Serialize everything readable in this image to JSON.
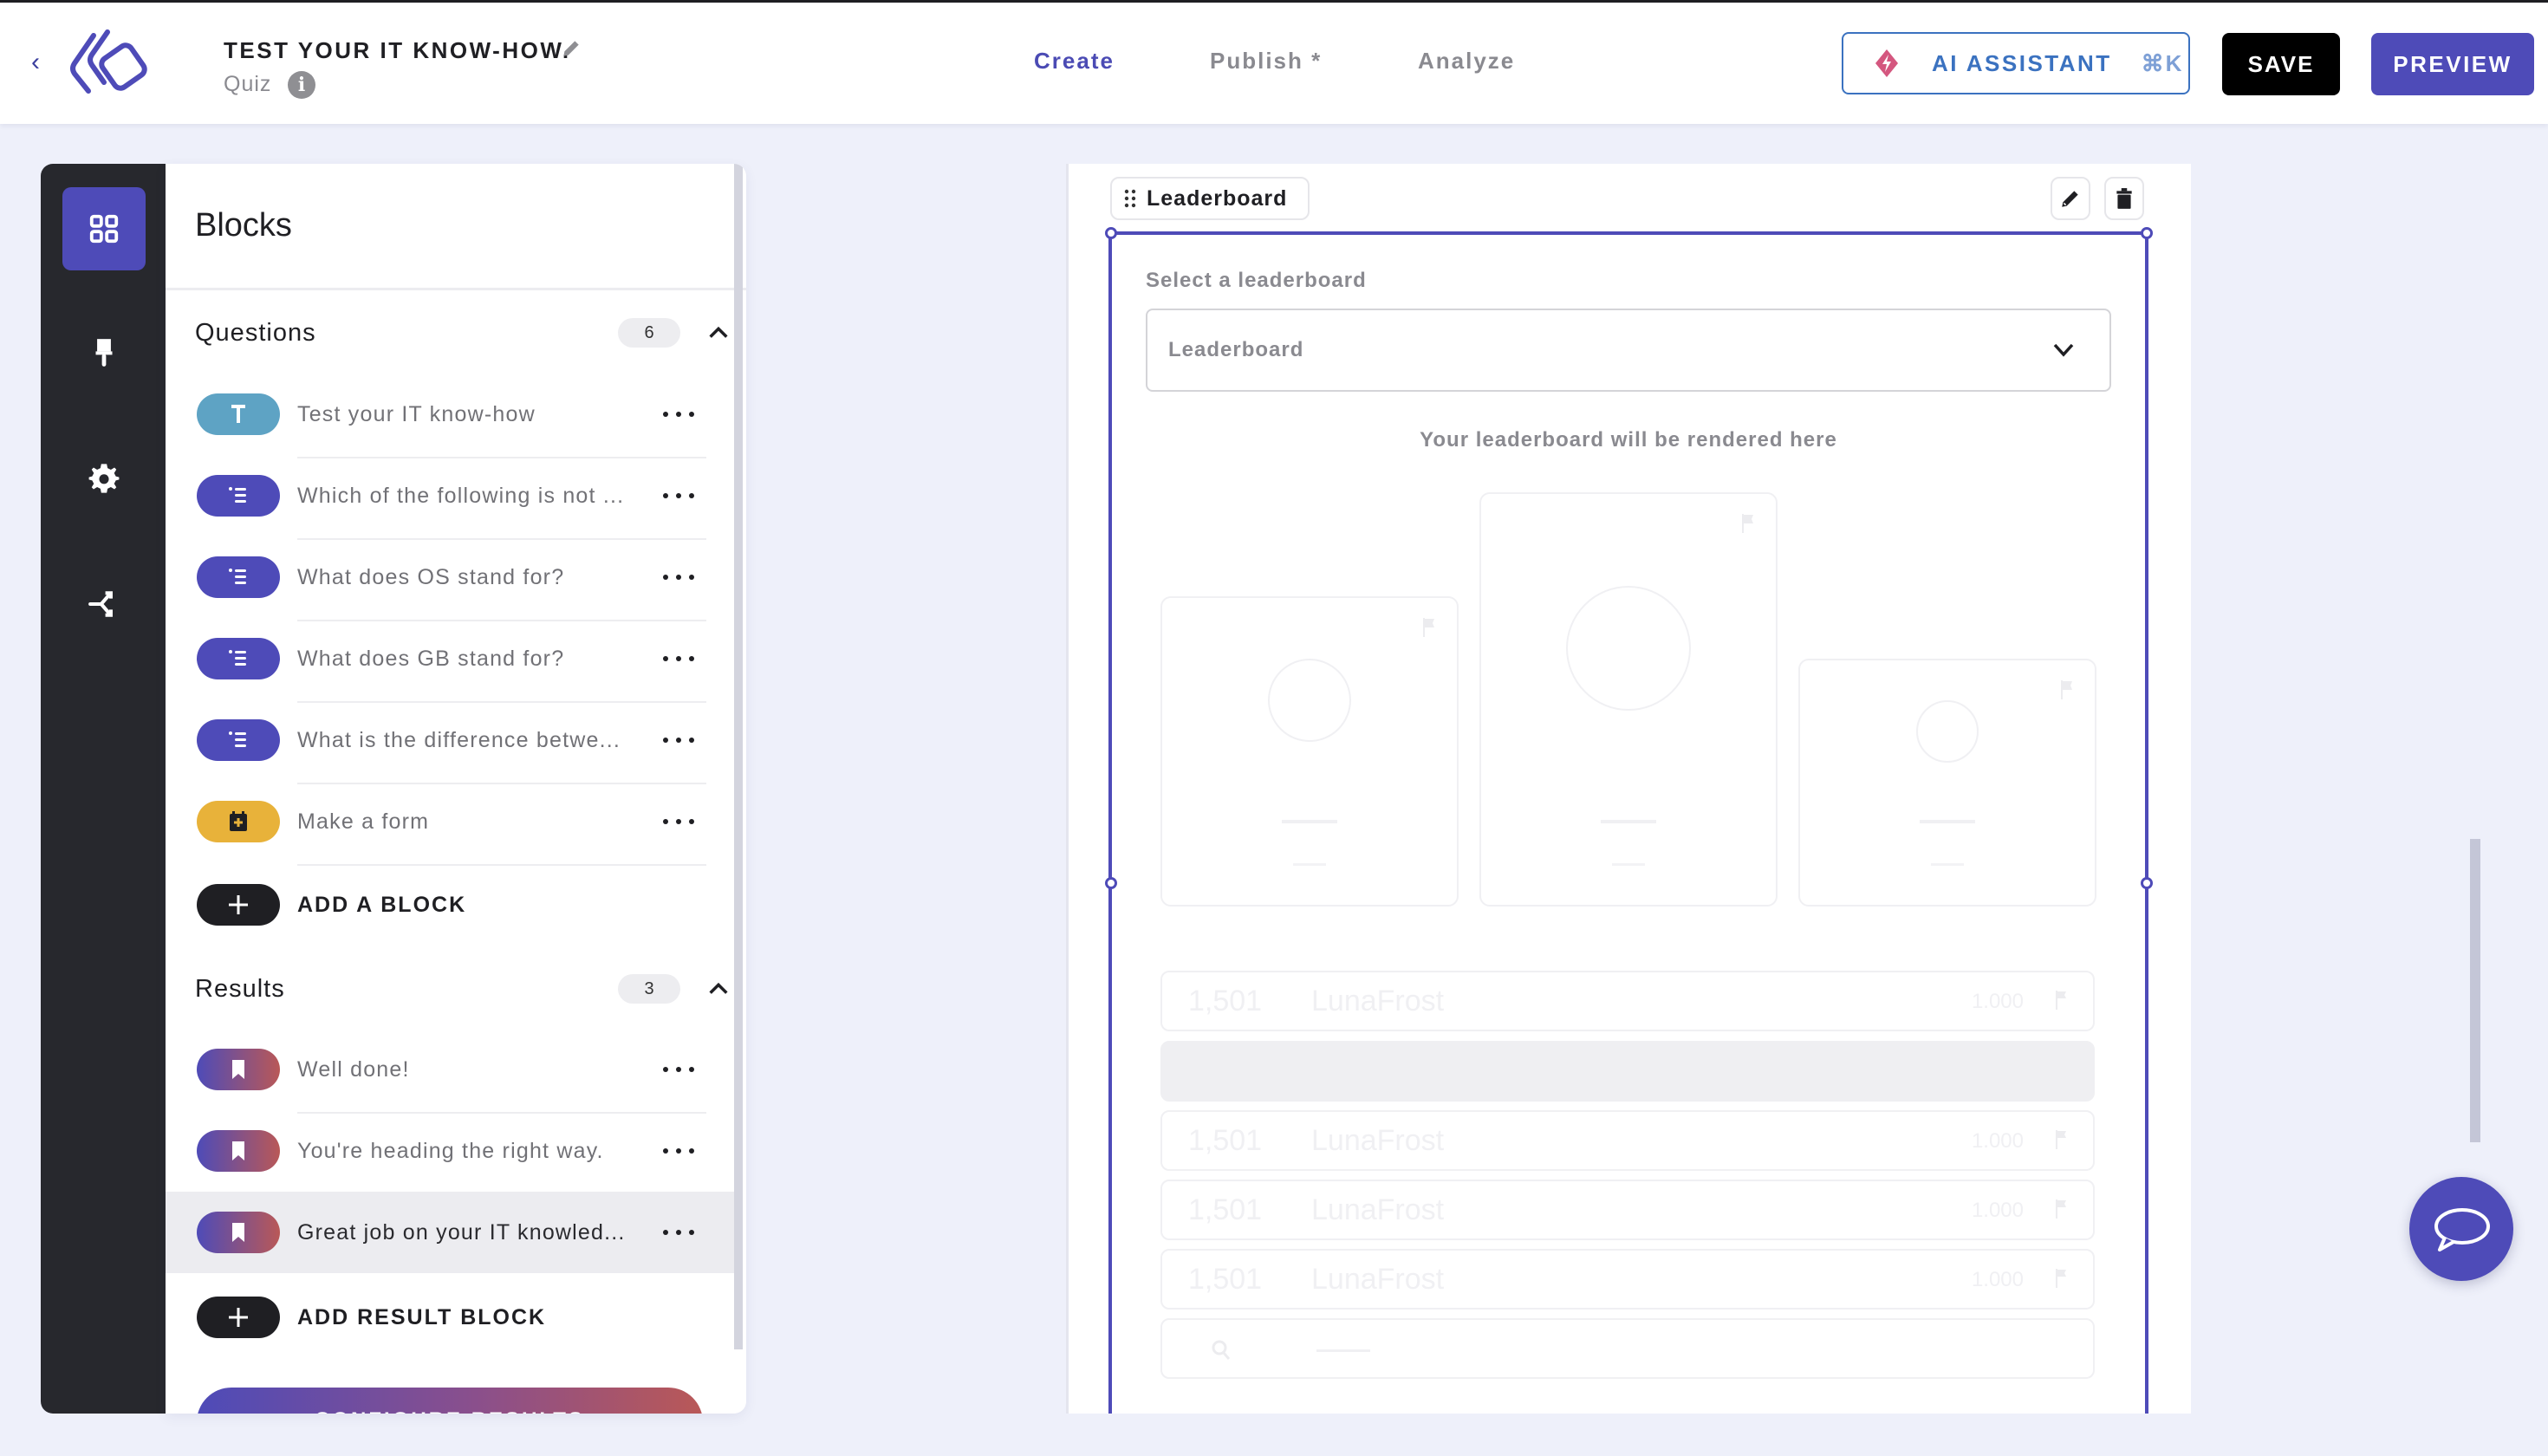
{
  "header": {
    "title": "TEST YOUR IT KNOW-HOW.",
    "type": "Quiz",
    "nav": [
      {
        "label": "Create",
        "active": true
      },
      {
        "label": "Publish *",
        "active": false
      },
      {
        "label": "Analyze",
        "active": false
      }
    ],
    "ai_assistant_label": "AI ASSISTANT",
    "ai_assistant_shortcut": "⌘K",
    "save_label": "SAVE",
    "preview_label": "PREVIEW"
  },
  "rail": {
    "items": [
      {
        "icon": "blocks-grid-icon",
        "active": true
      },
      {
        "icon": "paint-brush-icon",
        "active": false
      },
      {
        "icon": "gear-icon",
        "active": false
      },
      {
        "icon": "branch-logic-icon",
        "active": false
      }
    ]
  },
  "panel": {
    "title": "Blocks",
    "questions": {
      "title": "Questions",
      "count": "6",
      "items": [
        {
          "icon": "text-icon",
          "type": "text",
          "label": "Test your IT know-how"
        },
        {
          "icon": "list-icon",
          "type": "question",
          "label": "Which of the following is not ..."
        },
        {
          "icon": "list-icon",
          "type": "question",
          "label": "What does OS stand for?"
        },
        {
          "icon": "list-icon",
          "type": "question",
          "label": "What does GB stand for?"
        },
        {
          "icon": "list-icon",
          "type": "question",
          "label": "What is the difference betwe..."
        },
        {
          "icon": "form-icon",
          "type": "form",
          "label": "Make a form"
        }
      ],
      "add_label": "ADD A BLOCK"
    },
    "results": {
      "title": "Results",
      "count": "3",
      "items": [
        {
          "icon": "bookmark-icon",
          "label": "Well done!",
          "selected": false
        },
        {
          "icon": "bookmark-icon",
          "label": "You're heading the right way.",
          "selected": false
        },
        {
          "icon": "bookmark-icon",
          "label": "Great job on your IT knowled...",
          "selected": true
        }
      ],
      "add_label": "ADD RESULT BLOCK"
    },
    "configure_label": "CONFIGURE RESULTS"
  },
  "canvas": {
    "block_label": "Leaderboard",
    "select_label": "Select a leaderboard",
    "select_value": "Leaderboard",
    "render_note": "Your leaderboard will be rendered here",
    "rows": [
      {
        "rank": "1,501",
        "name": "LunaFrost",
        "score": "1.000",
        "highlight": false
      },
      {
        "rank": "",
        "name": "",
        "score": "",
        "highlight": true
      },
      {
        "rank": "1,501",
        "name": "LunaFrost",
        "score": "1.000",
        "highlight": false
      },
      {
        "rank": "1,501",
        "name": "LunaFrost",
        "score": "1.000",
        "highlight": false
      },
      {
        "rank": "1,501",
        "name": "LunaFrost",
        "score": "1.000",
        "highlight": false
      }
    ]
  },
  "colors": {
    "accent": "#4e4bb8",
    "text_pill": "#5ea3c4",
    "form_pill": "#e8b23a",
    "result_gradient_start": "#4e4bb8",
    "result_gradient_end": "#b95857",
    "ai_blue": "#3b72c0",
    "ai_pink": "#d4577f",
    "rail_bg": "#27282d"
  }
}
